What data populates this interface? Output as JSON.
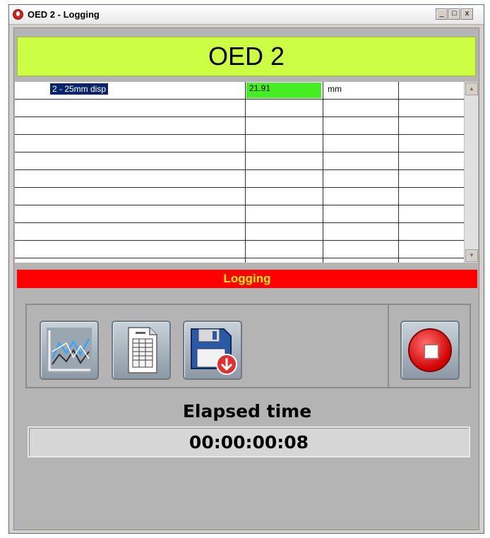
{
  "window": {
    "title": "OED 2 - Logging",
    "controls": {
      "minimize": "_",
      "maximize": "□",
      "close": "x"
    }
  },
  "header": {
    "title": "OED 2"
  },
  "grid": {
    "rows": [
      {
        "label": "2 - 25mm disp",
        "value": "21.91",
        "unit": "mm"
      }
    ],
    "value_highlight_color": "#44ee22",
    "selection_color": "#0a246a"
  },
  "status": {
    "text": "Logging",
    "bg_color": "#ff0000",
    "text_color": "#ffee00"
  },
  "toolbar": {
    "buttons": [
      {
        "name": "chart",
        "icon": "line-chart-icon"
      },
      {
        "name": "report",
        "icon": "document-icon"
      },
      {
        "name": "save",
        "icon": "floppy-disk-save-icon"
      },
      {
        "name": "stop",
        "icon": "stop-icon"
      }
    ]
  },
  "elapsed": {
    "label": "Elapsed time",
    "value": "00:00:00:08"
  }
}
